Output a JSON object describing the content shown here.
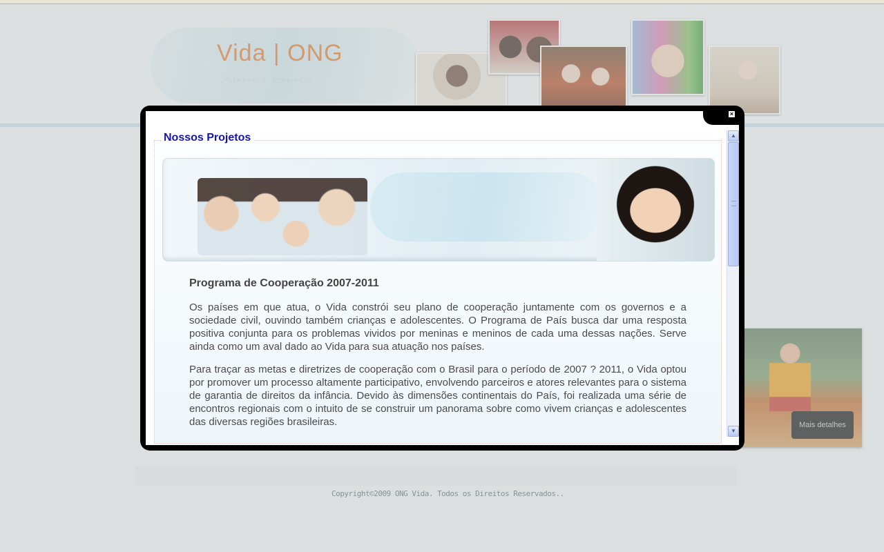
{
  "site": {
    "logo_text": "Vida | ONG",
    "logo_reflection": "Vida | ONG",
    "copyright": "Copyright©2009 ONG Vida. Todos os Direitos Reservados.."
  },
  "side_panel": {
    "more_details_label": "Mais detalhes"
  },
  "modal": {
    "legend": "Nossos Projetos",
    "close_icon": "close-icon",
    "article": {
      "title": "Programa de Cooperação 2007-2011",
      "paragraphs": [
        "Os países em que atua, o Vida constrói seu plano de cooperação juntamente com os governos e a sociedade civil, ouvindo também crianças e adolescentes. O Programa de País busca dar uma resposta positiva conjunta para os problemas vividos por meninas e meninos de cada uma dessas nações. Serve ainda como um aval dado ao Vida para sua atuação nos países.",
        "Para traçar as metas e diretrizes de cooperação com o Brasil para o período de 2007 ? 2011, o Vida optou por promover um processo altamente participativo, envolvendo parceiros e atores relevantes para o sistema de garantia de direitos da infância. Devido às dimensões continentais do País, foi realizada uma série de encontros regionais com o intuito de se construir um panorama sobre como vivem crianças e adolescentes das diversas regiões brasileiras."
      ]
    }
  },
  "colors": {
    "legend": "#1414b8",
    "logo": "#e07a2a",
    "modal_frame": "#000000"
  }
}
